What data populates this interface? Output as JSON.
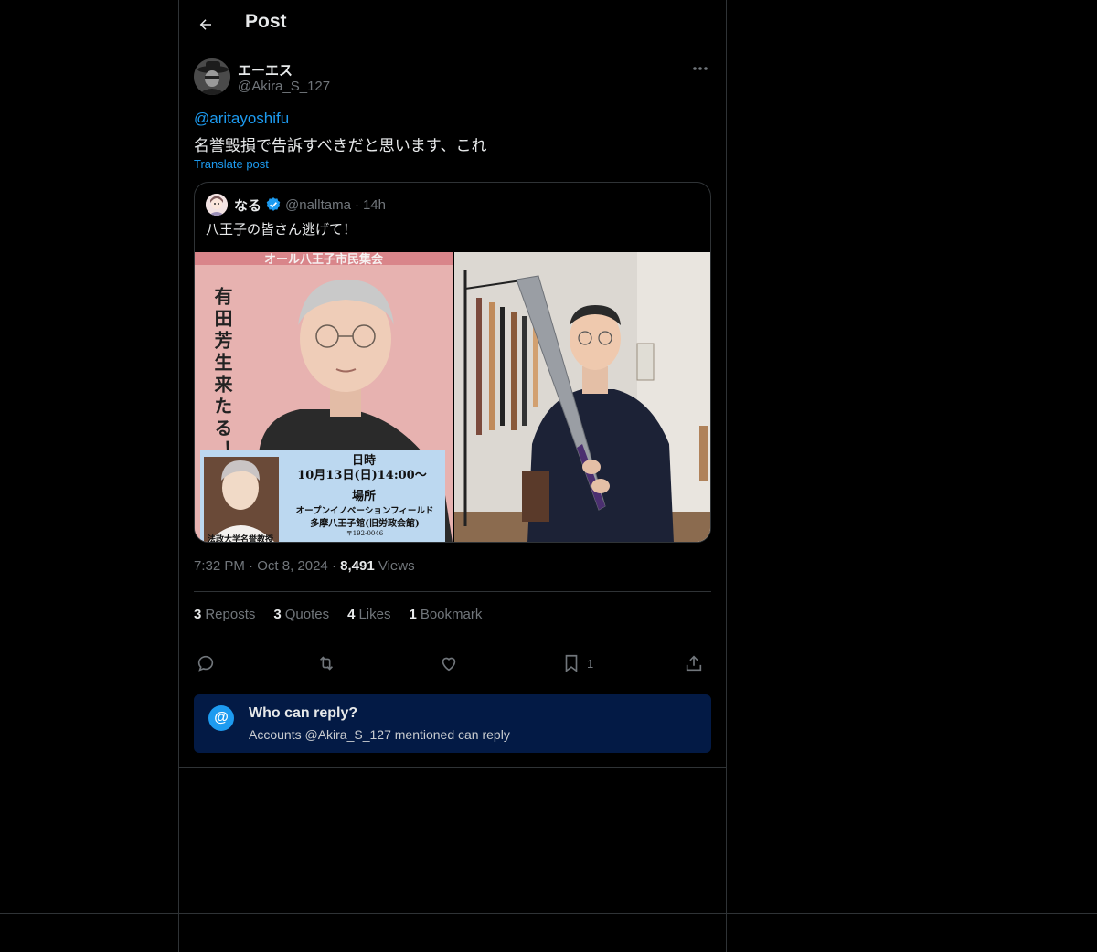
{
  "header": {
    "title": "Post"
  },
  "post": {
    "author_name": "エーエス",
    "author_handle": "@Akira_S_127",
    "mention": "@aritayoshifu",
    "text": "名誉毀損で告訴すべきだと思います、これ",
    "translate_label": "Translate post"
  },
  "quote": {
    "name": "なる",
    "handle": "@nalltama",
    "separator": "·",
    "time": "14h",
    "text": "八王子の皆さん逃げて！",
    "flyer": {
      "banner": "オール八王子市民集会",
      "vertical_text": "有田芳生来たる！",
      "date_label": "日時",
      "date_value": "10月13日(日)14:00〜",
      "place_label": "場所",
      "place_line1": "オープンイノベーションフィールド",
      "place_line2": "多摩八王子館(旧労政会館)",
      "postal": "〒192-0046",
      "caption": "法政大学名誉教授"
    }
  },
  "meta": {
    "time": "7:32 PM",
    "date": "Oct 8, 2024",
    "dot": "·",
    "views_count": "8,491",
    "views_label": "Views"
  },
  "stats": [
    {
      "count": "3",
      "label": "Reposts"
    },
    {
      "count": "3",
      "label": "Quotes"
    },
    {
      "count": "4",
      "label": "Likes"
    },
    {
      "count": "1",
      "label": "Bookmark"
    }
  ],
  "actions": {
    "bookmark_count": "1"
  },
  "reply_box": {
    "icon": "@",
    "title": "Who can reply?",
    "subtitle": "Accounts @Akira_S_127 mentioned can reply"
  },
  "icons": [
    "back-arrow-icon",
    "more-icon",
    "verified-badge-icon",
    "reply-icon",
    "repost-icon",
    "like-icon",
    "bookmark-icon",
    "share-icon"
  ],
  "colors": {
    "accent": "#1d9bf0",
    "muted": "#71767b",
    "reply_box_bg": "#031a45"
  }
}
